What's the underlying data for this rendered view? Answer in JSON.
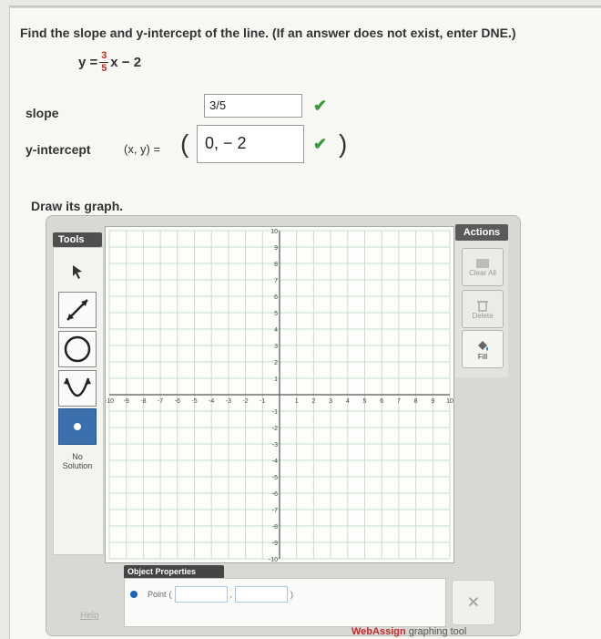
{
  "question": {
    "title": "Find the slope and y-intercept of the line. (If an answer does not exist, enter DNE.)",
    "equation": {
      "lhs": "y =",
      "numerator": "3",
      "denominator": "5",
      "rest": "x − 2"
    }
  },
  "answers": {
    "slope_label": "slope",
    "slope_value": "3/5",
    "intercept_label": "y-intercept",
    "intercept_prefix": "(x, y) =",
    "intercept_value": "0, − 2",
    "open_paren": "(",
    "close_paren": ")",
    "check_glyph": "✔"
  },
  "draw_title": "Draw its graph.",
  "tools": {
    "header": "Tools",
    "no_solution": [
      "No",
      "Solution"
    ],
    "icons": [
      "pointer-icon",
      "line-icon",
      "circle-icon",
      "parabola-icon",
      "point-icon"
    ]
  },
  "actions": {
    "header": "Actions",
    "items": [
      {
        "label": "Clear All",
        "icon": "clear-all-icon",
        "enabled": false
      },
      {
        "label": "Delete",
        "icon": "trash-icon",
        "enabled": false
      },
      {
        "label": "Fill",
        "icon": "fill-icon",
        "enabled": true
      }
    ]
  },
  "graph": {
    "x_range": [
      -10,
      10
    ],
    "y_range": [
      -10,
      10
    ],
    "x_ticks": [
      "-10",
      "-9",
      "-8",
      "-7",
      "-6",
      "-5",
      "-4",
      "-3",
      "-2",
      "-1",
      "1",
      "2",
      "3",
      "4",
      "5",
      "6",
      "7",
      "8",
      "9",
      "10"
    ],
    "y_ticks": [
      "10",
      "9",
      "8",
      "7",
      "6",
      "5",
      "4",
      "3",
      "2",
      "1",
      "-1",
      "-2",
      "-3",
      "-4",
      "-5",
      "-6",
      "-7",
      "-8",
      "-9",
      "-10"
    ],
    "grid": true
  },
  "properties": {
    "header": "Object Properties",
    "point_label": "Point",
    "open_paren": "(",
    "comma": ",",
    "close_paren": ")"
  },
  "footer": {
    "help": "Help",
    "brand_prefix": "WebAssign",
    "brand_suffix": " graphing tool"
  }
}
